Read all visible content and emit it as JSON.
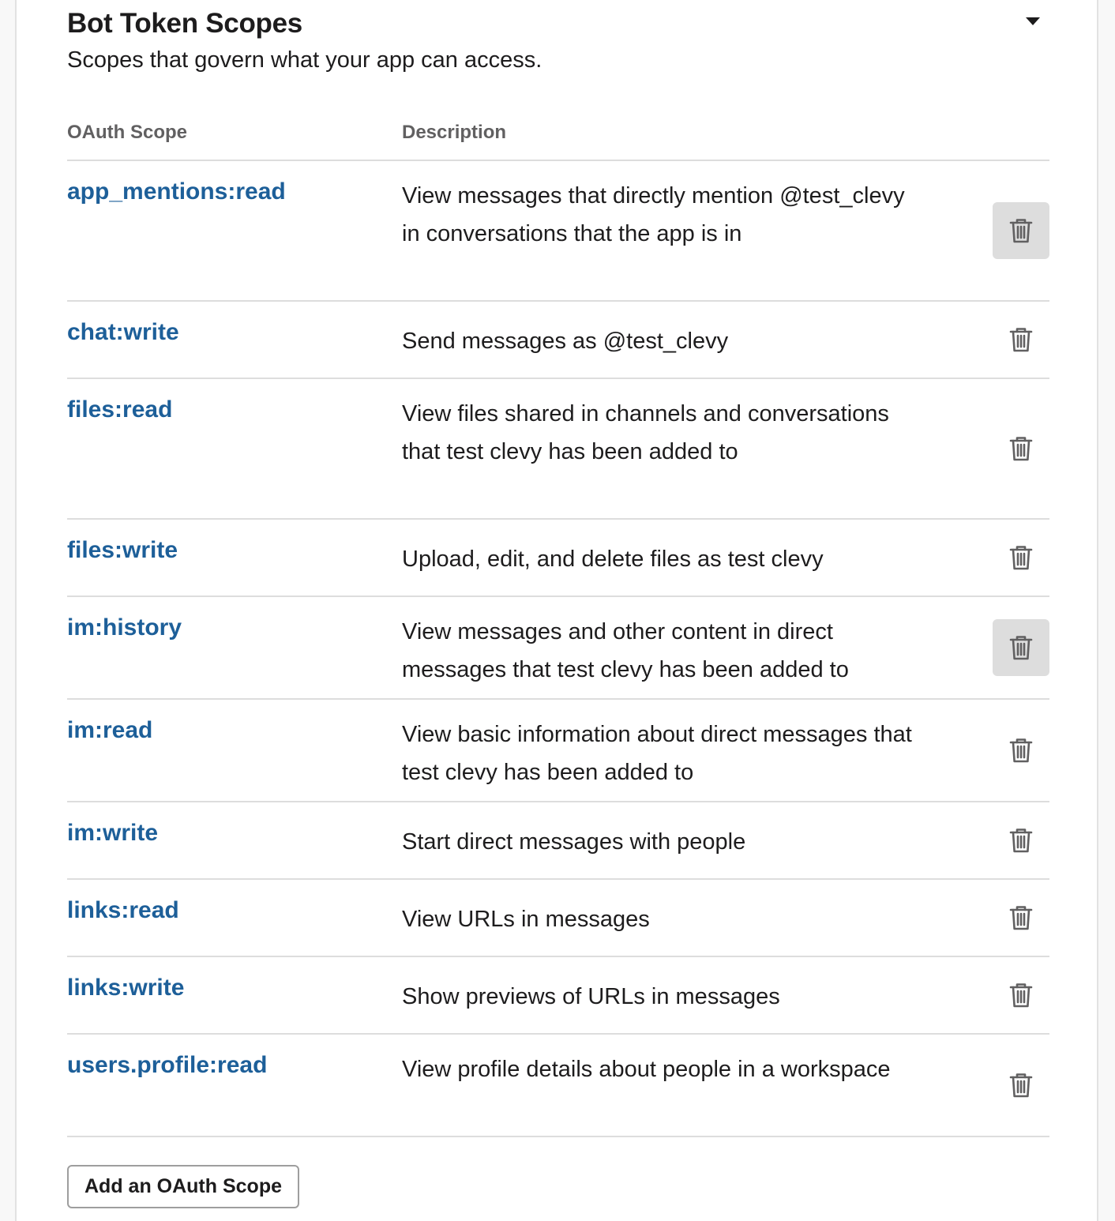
{
  "section": {
    "title": "Bot Token Scopes",
    "subtitle": "Scopes that govern what your app can access.",
    "toggle_icon": "caret-down-icon"
  },
  "table": {
    "headers": {
      "scope": "OAuth Scope",
      "description": "Description"
    },
    "rows": [
      {
        "scope": "app_mentions:read",
        "description": "View messages that directly mention @test_clevy in conversations that the app is in",
        "lines": 3,
        "highlighted": true
      },
      {
        "scope": "chat:write",
        "description": "Send messages as @test_clevy",
        "lines": 1,
        "highlighted": false
      },
      {
        "scope": "files:read",
        "description": "View files shared in channels and conversations that test clevy has been added to",
        "lines": 3,
        "highlighted": false
      },
      {
        "scope": "files:write",
        "description": "Upload, edit, and delete files as test clevy",
        "lines": 1,
        "highlighted": false
      },
      {
        "scope": "im:history",
        "description": "View messages and other content in direct messages that test clevy has been added to",
        "lines": 2,
        "highlighted": true
      },
      {
        "scope": "im:read",
        "description": "View basic information about direct messages that test clevy has been added to",
        "lines": 2,
        "highlighted": false
      },
      {
        "scope": "im:write",
        "description": "Start direct messages with people",
        "lines": 1,
        "highlighted": false
      },
      {
        "scope": "links:read",
        "description": "View URLs in messages",
        "lines": 1,
        "highlighted": false
      },
      {
        "scope": "links:write",
        "description": "Show previews of URLs in messages",
        "lines": 1,
        "highlighted": false
      },
      {
        "scope": "users.profile:read",
        "description": "View profile details about people in a workspace",
        "lines": 2,
        "highlighted": false
      }
    ],
    "row_action_icon": "trash-icon"
  },
  "add_button": {
    "label": "Add an OAuth Scope"
  },
  "colors": {
    "scope_link": "#1d5f99",
    "header_text": "#616061",
    "divider": "#dddddd",
    "hover_bg": "#dddddd"
  }
}
